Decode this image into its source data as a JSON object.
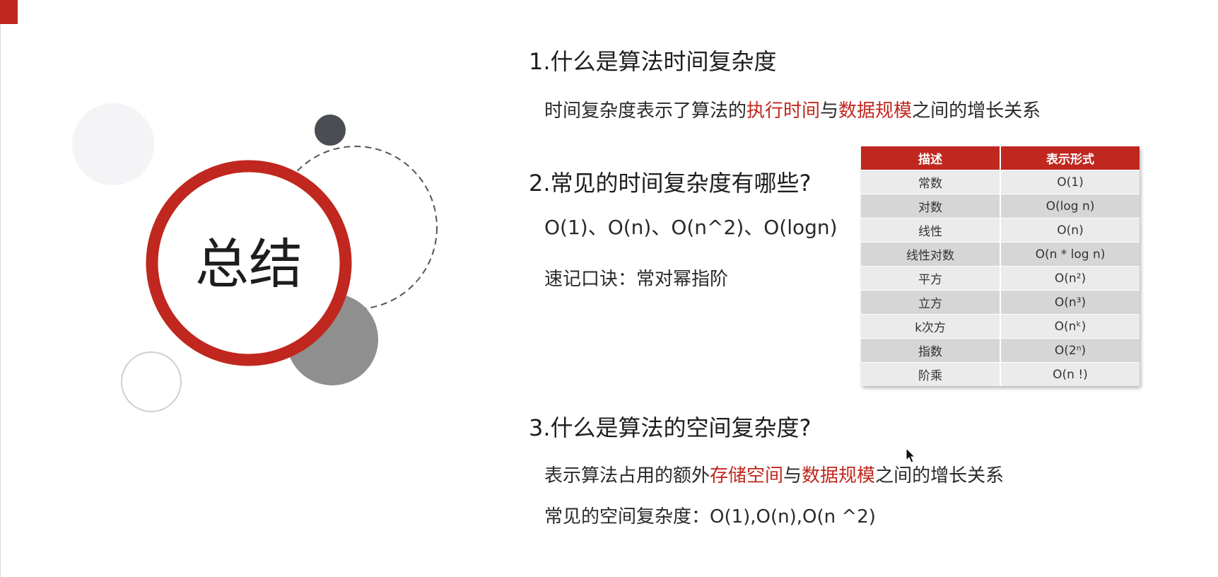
{
  "slide": {
    "title": "总结",
    "section1": {
      "heading": "1.什么是算法时间复杂度",
      "desc_parts": [
        "时间复杂度表示了算法的",
        "执行时间",
        "与",
        "数据规模",
        "之间的增长关系"
      ]
    },
    "section2": {
      "heading": "2.常见的时间复杂度有哪些?",
      "examples": "O(1)、O(n)、O(n^2)、O(logn)",
      "mnemonic": "速记口诀：常对幂指阶"
    },
    "section3": {
      "heading": "3.什么是算法的空间复杂度?",
      "desc_parts": [
        "表示算法占用的额外",
        "存储空间",
        "与",
        "数据规模",
        "之间的增长关系"
      ],
      "common": "常见的空间复杂度：O(1),O(n),O(n ^2)"
    },
    "complexity_table": {
      "headers": [
        "描述",
        "表示形式"
      ],
      "rows": [
        [
          "常数",
          "O(1)"
        ],
        [
          "对数",
          "O(log n)"
        ],
        [
          "线性",
          "O(n)"
        ],
        [
          "线性对数",
          "O(n * log n)"
        ],
        [
          "平方",
          "O(n²)"
        ],
        [
          "立方",
          "O(n³)"
        ],
        [
          "k次方",
          "O(nᵏ)"
        ],
        [
          "指数",
          "O(2ⁿ)"
        ],
        [
          "阶乘",
          "O(n !)"
        ]
      ]
    },
    "colors": {
      "accent_red": "#c0271e",
      "dark_circle": "#4a4d52",
      "gray_circle": "#8f8f8f"
    }
  }
}
